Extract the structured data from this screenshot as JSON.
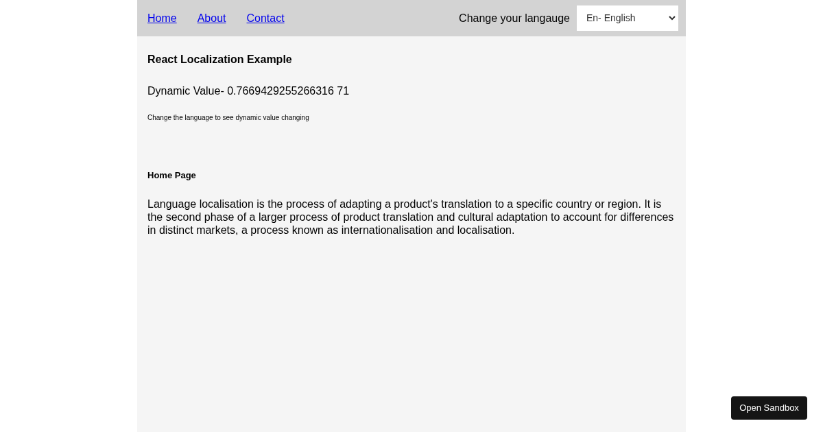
{
  "nav": {
    "links": [
      "Home",
      "About",
      "Contact"
    ],
    "language_label": "Change your langauge",
    "language_select": {
      "value": "En- English"
    }
  },
  "content": {
    "title": "React Localization Example",
    "dynamic_value": "Dynamic Value- 0.7669429255266316 71",
    "hint": "Change the language to see dynamic value changing",
    "page_heading": "Home Page",
    "paragraph": "Language localisation is the process of adapting a product's translation to a specific country or region. It is the second phase of a larger process of product translation and cultural adaptation to account for differences in distinct markets, a process known as internationalisation and localisation."
  },
  "sandbox_button": "Open Sandbox"
}
